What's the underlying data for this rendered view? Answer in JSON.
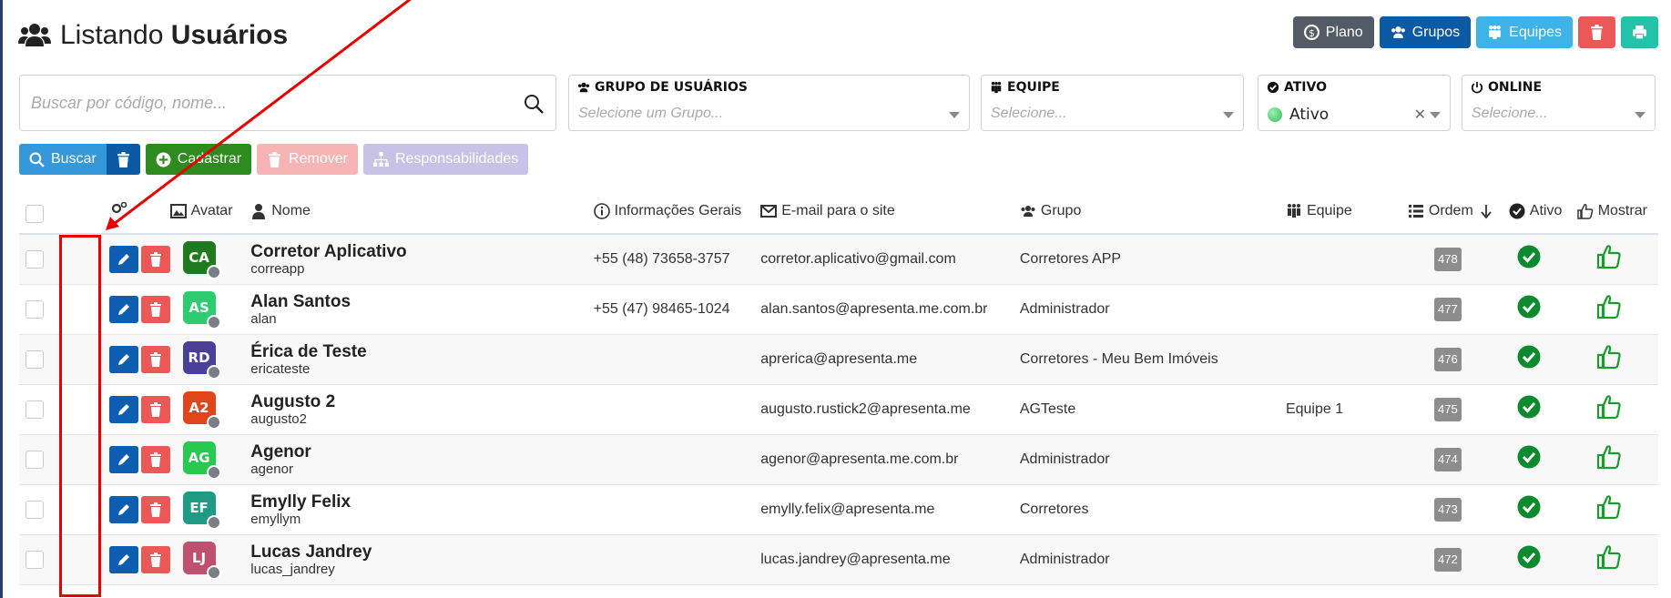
{
  "header": {
    "title_prefix": "Listando",
    "title_bold": "Usuários"
  },
  "top_buttons": [
    {
      "label": "Plano",
      "color": "#525b66"
    },
    {
      "label": "Grupos",
      "color": "#0b5aa3"
    },
    {
      "label": "Equipes",
      "color": "#3db3e8"
    },
    {
      "label": "",
      "color": "#ec5757"
    },
    {
      "label": "",
      "color": "#22c3a9"
    }
  ],
  "search": {
    "placeholder": "Buscar por código, nome..."
  },
  "filters": {
    "grupo": {
      "label": "GRUPO DE USUÁRIOS",
      "placeholder": "Selecione um Grupo..."
    },
    "equipe": {
      "label": "EQUIPE",
      "placeholder": "Selecione..."
    },
    "ativo": {
      "label": "ATIVO",
      "value": "Ativo"
    },
    "online": {
      "label": "ONLINE",
      "placeholder": "Selecione..."
    }
  },
  "actions": {
    "buscar": "Buscar",
    "cadastrar": "Cadastrar",
    "remover": "Remover",
    "responsabilidades": "Responsabilidades"
  },
  "table": {
    "columns": {
      "avatar": "Avatar",
      "nome": "Nome",
      "info": "Informações Gerais",
      "email": "E-mail para o site",
      "grupo": "Grupo",
      "equipe": "Equipe",
      "ordem": "Ordem",
      "ativo": "Ativo",
      "mostrar": "Mostrar"
    },
    "rows": [
      {
        "initials": "CA",
        "color": "#1f7a1f",
        "name": "Corretor Aplicativo",
        "login": "correapp",
        "phone": "+55 (48) 73658-3757",
        "email": "corretor.aplicativo@gmail.com",
        "group": "Corretores APP",
        "team": "",
        "order": "478"
      },
      {
        "initials": "AS",
        "color": "#2ecc71",
        "name": "Alan Santos",
        "login": "alan",
        "phone": "+55 (47) 98465-1024",
        "email": "alan.santos@apresenta.me.com.br",
        "group": "Administrador",
        "team": "",
        "order": "477"
      },
      {
        "initials": "RD",
        "color": "#4a3f99",
        "name": "Érica de Teste",
        "login": "ericateste",
        "phone": "",
        "email": "aprerica@apresenta.me",
        "group": "Corretores - Meu Bem Imóveis",
        "team": "",
        "order": "476"
      },
      {
        "initials": "A2",
        "color": "#e0461a",
        "name": "Augusto 2",
        "login": "augusto2",
        "phone": "",
        "email": "augusto.rustick2@apresenta.me",
        "group": "AGTeste",
        "team": "Equipe 1",
        "order": "475"
      },
      {
        "initials": "AG",
        "color": "#27c950",
        "name": "Agenor",
        "login": "agenor",
        "phone": "",
        "email": "agenor@apresenta.me.com.br",
        "group": "Administrador",
        "team": "",
        "order": "474"
      },
      {
        "initials": "EF",
        "color": "#1e9b85",
        "name": "Emylly Felix",
        "login": "emyllym",
        "phone": "",
        "email": "emylly.felix@apresenta.me",
        "group": "Corretores",
        "team": "",
        "order": "473"
      },
      {
        "initials": "LJ",
        "color": "#c0506f",
        "name": "Lucas Jandrey",
        "login": "lucas_jandrey",
        "phone": "",
        "email": "lucas.jandrey@apresenta.me",
        "group": "Administrador",
        "team": "",
        "order": "472"
      }
    ]
  },
  "colors": {
    "edit": "#0d5db1",
    "delete": "#ec5757",
    "active_check": "#0e8a2e",
    "annotation": "#e60000"
  }
}
